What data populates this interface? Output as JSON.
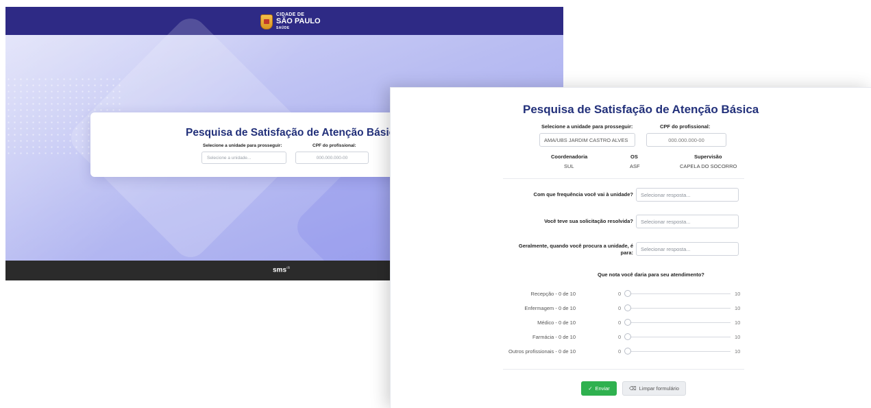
{
  "brand": {
    "line1": "CIDADE DE",
    "line2": "SÃO PAULO",
    "line3": "SAÚDE"
  },
  "landing": {
    "title": "Pesquisa de Satisfação de Atenção Básica",
    "unit_label": "Selecione a unidade para prosseguir:",
    "unit_placeholder": "Selecione a unidade...",
    "cpf_label": "CPF do profissional:",
    "cpf_placeholder": "000.000.000-00",
    "footer_logo": "sms",
    "footer_logo_sup": "dti"
  },
  "form": {
    "title": "Pesquisa de Satisfação de Atenção Básica",
    "unit_label": "Selecione a unidade para prosseguir:",
    "unit_value": "AMA/UBS JARDIM CASTRO ALVES",
    "cpf_label": "CPF do profissional:",
    "cpf_placeholder": "000.000.000-00",
    "info": {
      "coordenadoria_label": "Coordenadoria",
      "coordenadoria_value": "SUL",
      "os_label": "OS",
      "os_value": "ASF",
      "supervisao_label": "Supervisão",
      "supervisao_value": "CAPELA DO SOCORRO"
    },
    "questions": [
      {
        "label": "Com que frequência você vai à unidade?",
        "placeholder": "Selecionar resposta..."
      },
      {
        "label": "Você teve sua solicitação resolvida?",
        "placeholder": "Selecionar resposta..."
      },
      {
        "label": "Geralmente, quando você procura a unidade, é para:",
        "placeholder": "Selecionar resposta..."
      }
    ],
    "ratings_title": "Que nota você daria para seu atendimento?",
    "ratings": [
      {
        "label": "Recepção - 0 de 10",
        "min": "0",
        "max": "10",
        "value": 0
      },
      {
        "label": "Enfermagem - 0 de 10",
        "min": "0",
        "max": "10",
        "value": 0
      },
      {
        "label": "Médico - 0 de 10",
        "min": "0",
        "max": "10",
        "value": 0
      },
      {
        "label": "Farmácia - 0 de 10",
        "min": "0",
        "max": "10",
        "value": 0
      },
      {
        "label": "Outros profissionais - 0 de 10",
        "min": "0",
        "max": "10",
        "value": 0
      }
    ],
    "submit_label": "Enviar",
    "clear_label": "Limpar formulário"
  },
  "colors": {
    "header": "#2e2a85",
    "title": "#22307a",
    "submit": "#2fb14f",
    "footer": "#2b2b2b"
  }
}
